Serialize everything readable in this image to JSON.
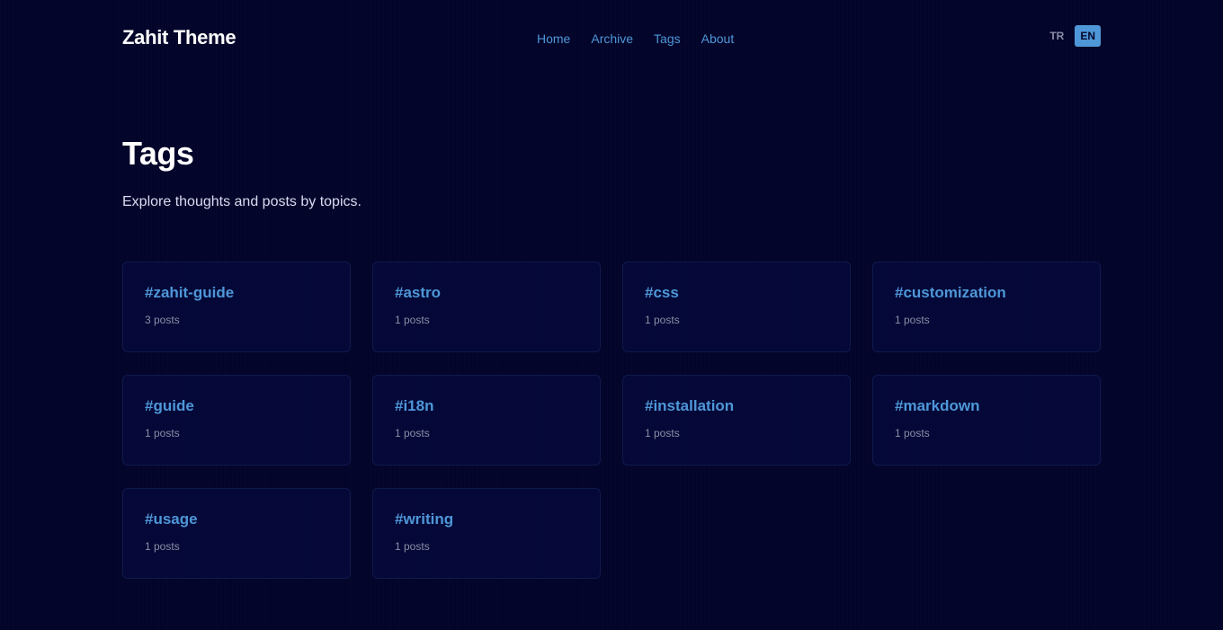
{
  "header": {
    "brand": "Zahit Theme",
    "nav": {
      "home": "Home",
      "archive": "Archive",
      "tags": "Tags",
      "about": "About"
    },
    "languages": {
      "tr": "TR",
      "en": "EN",
      "active": "EN"
    }
  },
  "main": {
    "title": "Tags",
    "subtitle": "Explore thoughts and posts by topics.",
    "tags": [
      {
        "name": "#zahit-guide",
        "count": "3 posts"
      },
      {
        "name": "#astro",
        "count": "1 posts"
      },
      {
        "name": "#css",
        "count": "1 posts"
      },
      {
        "name": "#customization",
        "count": "1 posts"
      },
      {
        "name": "#guide",
        "count": "1 posts"
      },
      {
        "name": "#i18n",
        "count": "1 posts"
      },
      {
        "name": "#installation",
        "count": "1 posts"
      },
      {
        "name": "#markdown",
        "count": "1 posts"
      },
      {
        "name": "#usage",
        "count": "1 posts"
      },
      {
        "name": "#writing",
        "count": "1 posts"
      }
    ]
  },
  "colors": {
    "background": "#03042a",
    "accent": "#4e97d8",
    "card_border": "#0f1a4d",
    "muted_text": "#8a8fa6"
  }
}
